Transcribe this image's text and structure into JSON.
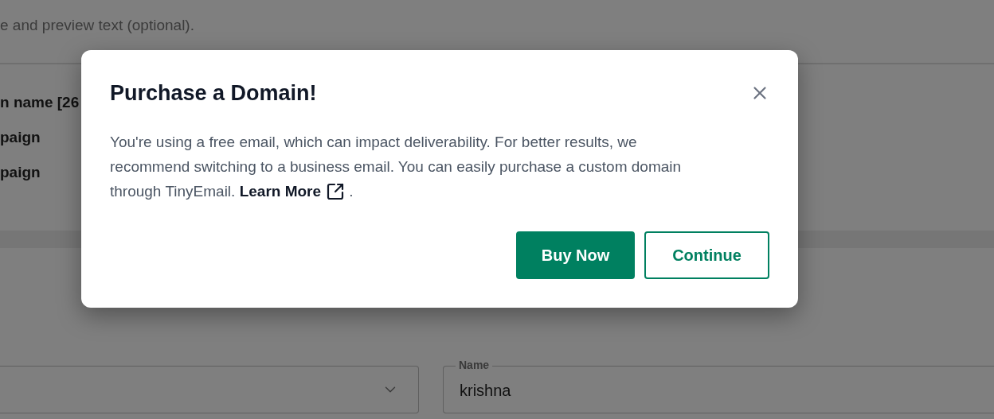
{
  "background": {
    "intro_text": "e and preview text (optional).",
    "list_items": [
      "n name [26",
      "paign",
      "paign"
    ],
    "fields": [
      {
        "kind": "select"
      },
      {
        "kind": "text",
        "label": "Name",
        "value": "krishna"
      }
    ]
  },
  "dialog": {
    "title": "Purchase a Domain!",
    "body": "You're using a free email, which can impact deliverability. For better results, we recommend switching to a business email. You can easily purchase a custom domain through TinyEmail.",
    "link": "Learn More",
    "after_link": ".",
    "buttons": [
      {
        "label": "Buy Now",
        "kind": "primary"
      },
      {
        "label": "Continue",
        "kind": "secondary"
      }
    ]
  }
}
